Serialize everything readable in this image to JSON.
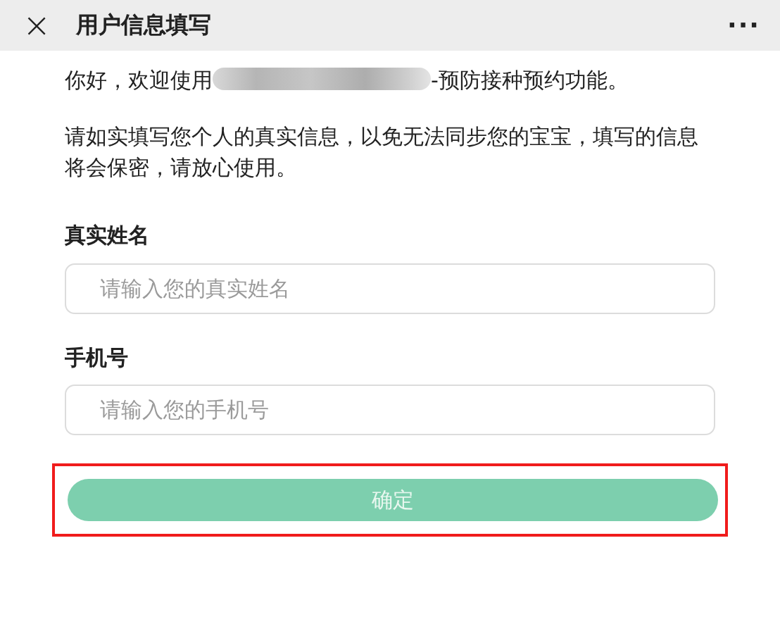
{
  "header": {
    "close_icon": "×",
    "title": "用户信息填写",
    "more": "···"
  },
  "intro": {
    "before": "你好，欢迎使用",
    "redacted": true,
    "after": "-预防接种预约功能。"
  },
  "notice": "请如实填写您个人的真实信息，以免无法同步您的宝宝，填写的信息将会保密，请放心使用。",
  "fields": [
    {
      "label": "真实姓名",
      "placeholder": "请输入您的真实姓名"
    },
    {
      "label": "手机号",
      "placeholder": "请输入您的手机号"
    }
  ],
  "submit": {
    "label": "确定",
    "disabled": true,
    "highlighted": true
  }
}
